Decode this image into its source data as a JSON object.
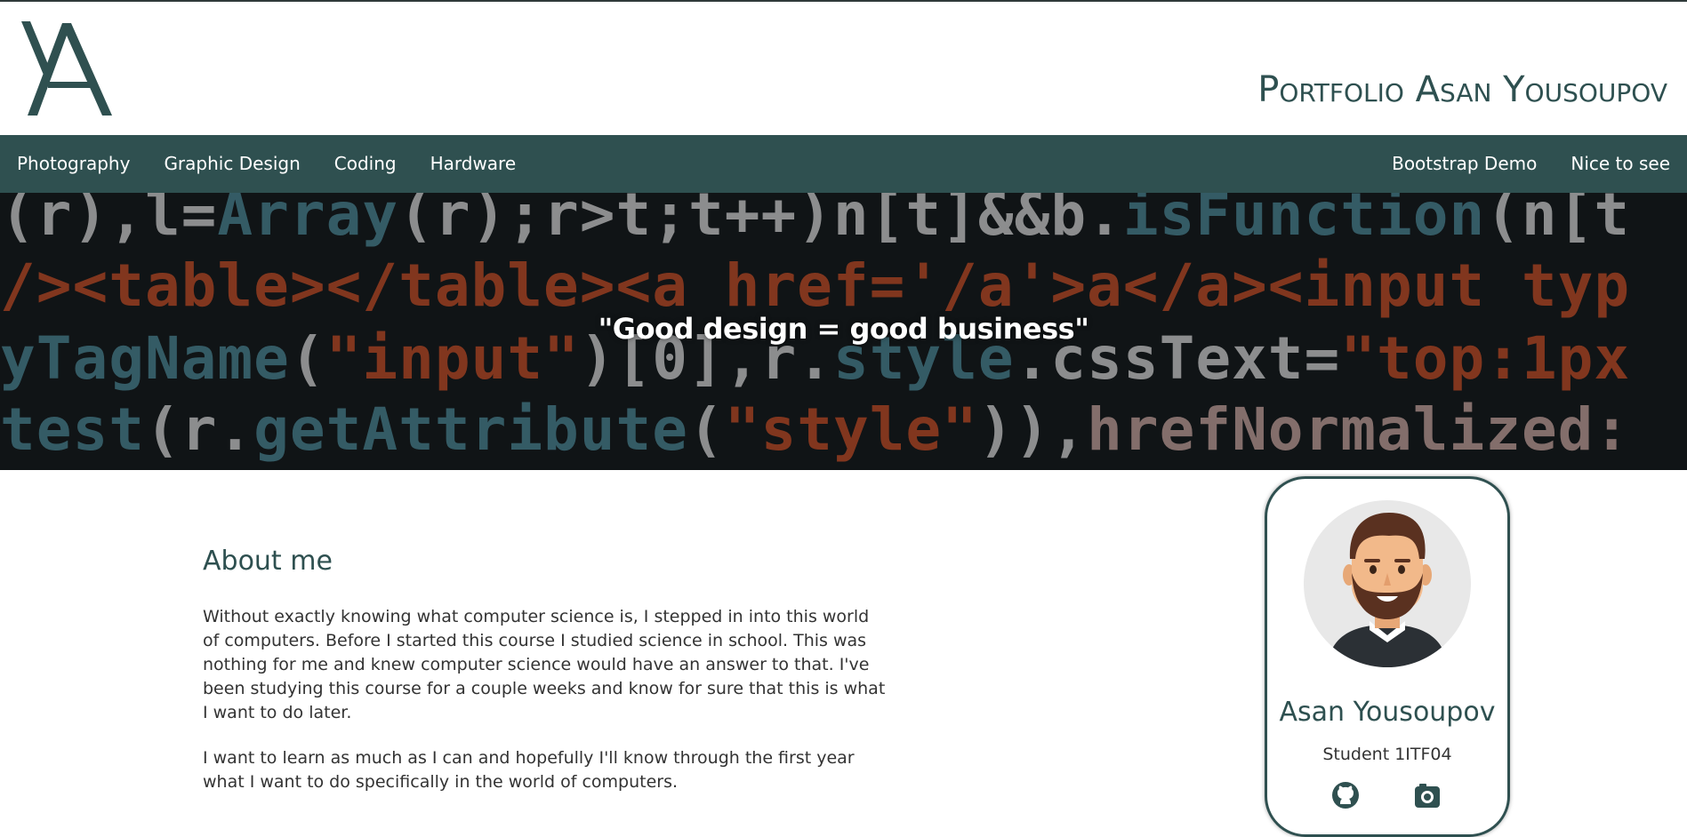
{
  "header": {
    "title": "Portfolio Asan Yousoupov",
    "logo_icon": "ya-monogram-logo"
  },
  "nav": {
    "left": [
      "Photography",
      "Graphic Design",
      "Coding",
      "Hardware"
    ],
    "right": [
      "Bootstrap Demo",
      "Nice to see"
    ]
  },
  "hero": {
    "quote": "\"Good design = good business\""
  },
  "about": {
    "title": "About me",
    "paragraphs": [
      "Without exactly knowing what computer science is, I stepped in into this world of computers. Before I started this course I studied science in school. This was nothing for me and knew computer science would have an answer to that. I've been studying this course for a couple weeks and know for sure that this is what I want to do later.",
      "I want to learn as much as I can and hopefully I'll know through the first year what I want to do specifically in the world of computers."
    ]
  },
  "profile": {
    "name": "Asan Yousoupov",
    "subtitle": "Student 1ITF04",
    "avatar_icon": "bearded-man-avatar",
    "social_icons": [
      "github-icon",
      "camera-icon"
    ]
  },
  "colors": {
    "brand": "#2f5050",
    "text": "#333333",
    "hero_bg": "#151a1d"
  }
}
